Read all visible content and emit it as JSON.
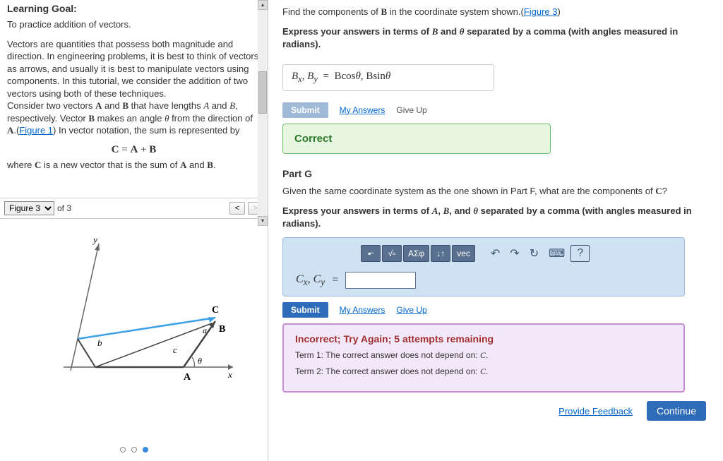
{
  "left": {
    "title": "Learning Goal:",
    "p1": "To practice addition of vectors.",
    "p2a": "Vectors are quantities that possess both magnitude and direction. In engineering problems, it is best to think of vectors as arrows, and usually it is best to manipulate vectors using components. In this tutorial, we consider the addition of two vectors using both of these techniques.",
    "p2b_pre": "Consider two vectors ",
    "p2b_mid1": " and ",
    "p2b_mid2": " that have lengths ",
    "p2b_mid3": " and ",
    "p2b_mid4": ", respectively. Vector ",
    "p2b_mid5": " makes an angle ",
    "p2b_mid6": " from the direction of ",
    "p2b_link": "Figure 1",
    "p2b_end": ") In vector notation, the sum is represented by",
    "eq": "C = A + B",
    "p3_pre": "where ",
    "p3_mid": " is a new vector that is the sum of ",
    "p3_mid2": " and ",
    "p3_end": ".",
    "figure_sel": "Figure 3",
    "figure_of": "of 3"
  },
  "right": {
    "f_instr_pre": "Find the components of ",
    "f_instr_mid": " in the coordinate system shown.(",
    "f_link": "Figure 3",
    "f_instr_end": ")",
    "f_bold": "Express your answers in terms of B and θ separated by a comma (with angles measured in radians).",
    "f_ans_lhs": "Bₓ, B_y =",
    "f_ans_rhs": "Bcosθ, Bsinθ",
    "submit": "Submit",
    "my_answers": "My Answers",
    "give_up": "Give Up",
    "correct": "Correct",
    "partG": "Part G",
    "g_instr": "Given the same coordinate system as the one shown in Part F, what are the components of C?",
    "g_bold": "Express your answers in terms of A, B, and θ separated by a comma (with angles measured in radians).",
    "g_lhs": "Cₓ, C_y =",
    "tool_greek": "ΑΣφ",
    "tool_vec": "vec",
    "tool_help": "?",
    "inc_title": "Incorrect; Try Again; 5 attempts remaining",
    "inc_l1": "Term 1: The correct answer does not depend on: C.",
    "inc_l2": "Term 2: The correct answer does not depend on: C.",
    "feedback": "Provide Feedback",
    "continue": "Continue"
  },
  "chart_data": {
    "type": "diagram",
    "description": "Vector diagram with origin at A on x-axis. Vector A along +x. Vector B from A at angle θ above x-axis terminating at point B. Vector C (blue) from origin y-axis intersection region to B. Small vectors b (vertical) and c along the bottom triangle. Axes labeled x and y.",
    "labels": [
      "x",
      "y",
      "A",
      "B",
      "C",
      "a",
      "b",
      "c",
      "θ"
    ],
    "axes": {
      "x": "x",
      "y": "y"
    }
  }
}
